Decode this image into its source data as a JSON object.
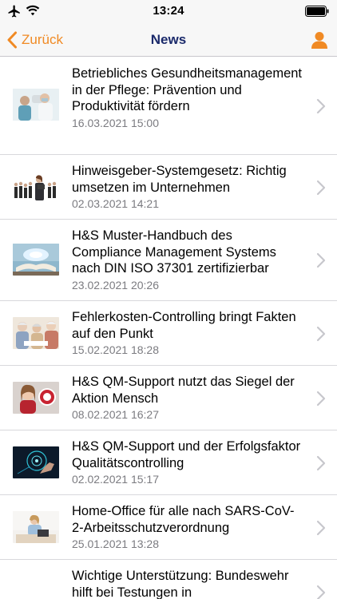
{
  "status_bar": {
    "time": "13:24",
    "icons": [
      "airplane-mode-icon",
      "wifi-icon",
      "battery-icon"
    ]
  },
  "nav": {
    "back_label": "Zurück",
    "title": "News",
    "right_icon": "user-profile-icon"
  },
  "colors": {
    "accent": "#f08a24",
    "title": "#1b2a6b",
    "date": "#7b7b80"
  },
  "news": [
    {
      "headline": "Betriebliches Gesundheitsmanagement in der Pflege: Prävention und Produktivität fördern",
      "date": "16.03.2021 15:00",
      "thumb": "nurse-and-patient-photo"
    },
    {
      "headline": "Hinweisgeber-Systemgesetz: Richtig umsetzen im Unternehmen",
      "date": "02.03.2021 14:21",
      "thumb": "business-people-group-photo"
    },
    {
      "headline": "H&S Muster-Handbuch des Compliance Management Systems nach DIN ISO 37301 zertifizierbar",
      "date": "23.02.2021 20:26",
      "thumb": "open-book-glow-photo"
    },
    {
      "headline": "Fehlerkosten-Controlling bringt Fakten auf den Punkt",
      "date": "15.02.2021 18:28",
      "thumb": "elderly-people-photo"
    },
    {
      "headline": "H&S QM-Support nutzt das Siegel der Aktion Mensch",
      "date": "08.02.2021 16:27",
      "thumb": "smiling-girl-with-seal-photo"
    },
    {
      "headline": "H&S QM-Support und der Erfolgsfaktor Qualitätscontrolling",
      "date": "02.02.2021 15:17",
      "thumb": "digital-touch-dark-photo"
    },
    {
      "headline": "Home-Office für alle nach SARS-CoV-2-Arbeitsschutzverordnung",
      "date": "25.01.2021 13:28",
      "thumb": "woman-at-laptop-photo"
    },
    {
      "headline": "Wichtige Unterstützung: Bundeswehr hilft bei Testungen in",
      "date": "",
      "thumb": ""
    }
  ]
}
